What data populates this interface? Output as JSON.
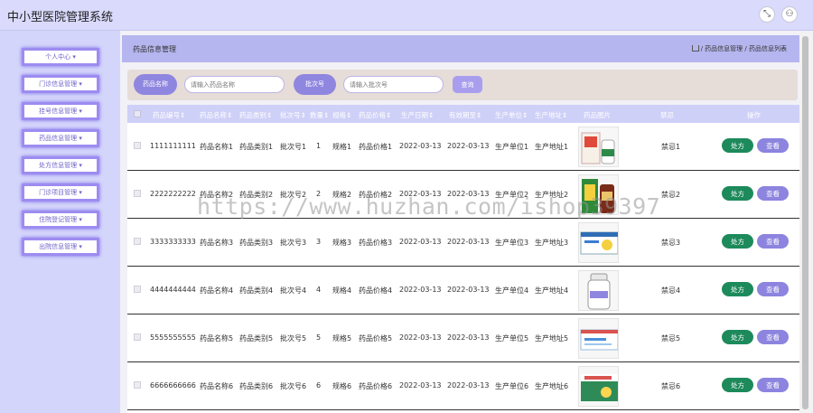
{
  "app": {
    "title": "中小型医院管理系统"
  },
  "sidebar": {
    "items": [
      {
        "label": "个人中心 ▾"
      },
      {
        "label": "门诊信息管理 ▾"
      },
      {
        "label": "挂号信息管理 ▾"
      },
      {
        "label": "药品信息管理 ▾"
      },
      {
        "label": "处方信息管理 ▾"
      },
      {
        "label": "门诊项目管理 ▾"
      },
      {
        "label": "住院登记管理 ▾"
      },
      {
        "label": "出院信息管理 ▾"
      }
    ]
  },
  "breadcrumb": {
    "title": "药品信息管理",
    "path": "/ 药品信息管理 / 药品信息列表"
  },
  "search": {
    "name_label": "药品名称",
    "name_placeholder": "请输入药品名称",
    "batch_label": "批次号",
    "batch_placeholder": "请输入批次号",
    "query_label": "查询"
  },
  "table": {
    "headers": [
      "药品编号",
      "药品名称",
      "药品类别",
      "批次号",
      "数量",
      "规格",
      "药品价格",
      "生产日期",
      "有效期至",
      "生产单位",
      "生产地址",
      "药品图片",
      "禁忌",
      "操作"
    ],
    "header_sort_mark": "⇕",
    "rx_label": "处方",
    "view_label": "查看",
    "rows": [
      {
        "code": "1111111111",
        "name": "药品名称1",
        "category": "药品类别1",
        "batch": "批次号1",
        "qty": "1",
        "spec": "规格1",
        "price": "药品价格1",
        "prod_date": "2022-03-13",
        "expire": "2022-03-13",
        "maker": "生产单位1",
        "address": "生产地址1",
        "taboo": "禁忌1"
      },
      {
        "code": "2222222222",
        "name": "药品名称2",
        "category": "药品类别2",
        "batch": "批次号2",
        "qty": "2",
        "spec": "规格2",
        "price": "药品价格2",
        "prod_date": "2022-03-13",
        "expire": "2022-03-13",
        "maker": "生产单位2",
        "address": "生产地址2",
        "taboo": "禁忌2"
      },
      {
        "code": "3333333333",
        "name": "药品名称3",
        "category": "药品类别3",
        "batch": "批次号3",
        "qty": "3",
        "spec": "规格3",
        "price": "药品价格3",
        "prod_date": "2022-03-13",
        "expire": "2022-03-13",
        "maker": "生产单位3",
        "address": "生产地址3",
        "taboo": "禁忌3"
      },
      {
        "code": "4444444444",
        "name": "药品名称4",
        "category": "药品类别4",
        "batch": "批次号4",
        "qty": "4",
        "spec": "规格4",
        "price": "药品价格4",
        "prod_date": "2022-03-13",
        "expire": "2022-03-13",
        "maker": "生产单位4",
        "address": "生产地址4",
        "taboo": "禁忌4"
      },
      {
        "code": "5555555555",
        "name": "药品名称5",
        "category": "药品类别5",
        "batch": "批次号5",
        "qty": "5",
        "spec": "规格5",
        "price": "药品价格5",
        "prod_date": "2022-03-13",
        "expire": "2022-03-13",
        "maker": "生产单位5",
        "address": "生产地址5",
        "taboo": "禁忌5"
      },
      {
        "code": "6666666666",
        "name": "药品名称6",
        "category": "药品类别6",
        "batch": "批次号6",
        "qty": "6",
        "spec": "规格6",
        "price": "药品价格6",
        "prod_date": "2022-03-13",
        "expire": "2022-03-13",
        "maker": "生产单位6",
        "address": "生产地址6",
        "taboo": "禁忌6"
      }
    ]
  },
  "watermark": "https://www.huzhan.com/ishop39397",
  "colors": {
    "accent": "#8f86e0",
    "rx_button": "#1d8a5b",
    "header_bg": "#d9dafc"
  }
}
